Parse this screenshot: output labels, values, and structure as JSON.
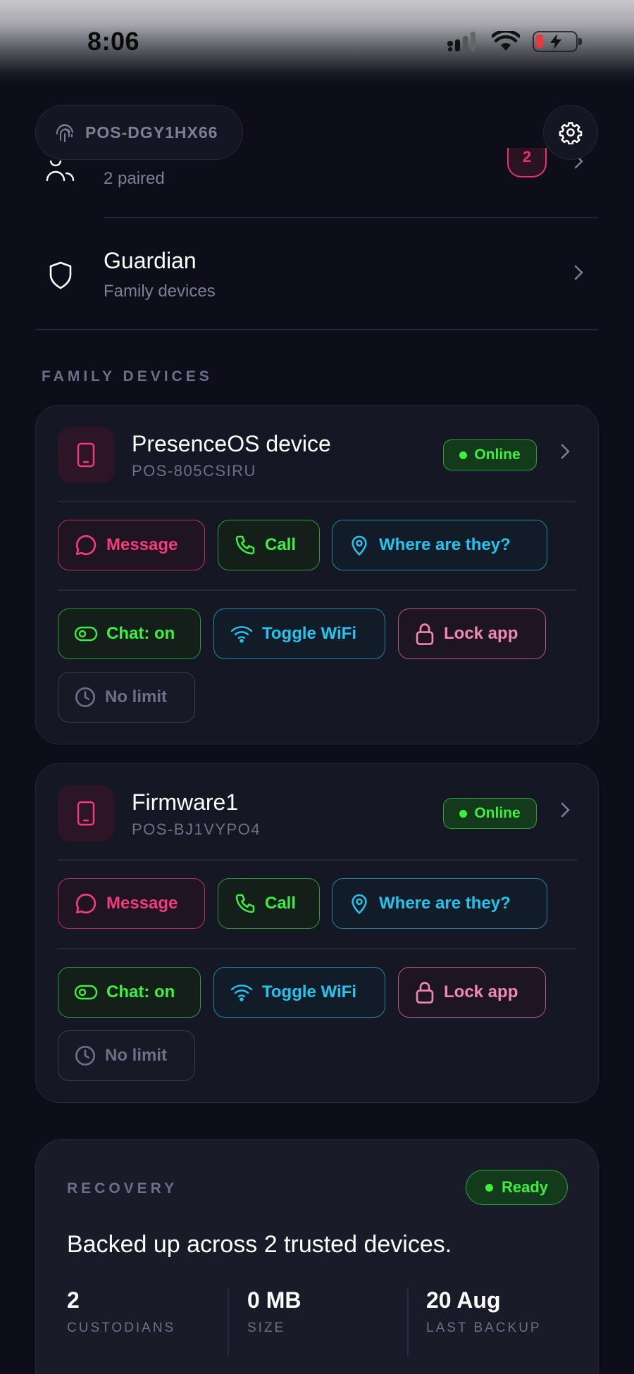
{
  "status_bar": {
    "time": "8:06"
  },
  "header": {
    "device_id": "POS-DGY1HX66"
  },
  "rows": {
    "partial": {
      "subtitle": "2 paired",
      "badge": "2"
    },
    "guardian": {
      "title": "Guardian",
      "subtitle": "Family devices"
    }
  },
  "section_title": "FAMILY DEVICES",
  "devices": [
    {
      "name": "PresenceOS device",
      "id": "POS-805CSIRU",
      "status": "Online",
      "actions": {
        "message": "Message",
        "call": "Call",
        "locate": "Where are they?"
      },
      "controls": {
        "chat": "Chat: on",
        "wifi": "Toggle WiFi",
        "lock": "Lock app",
        "limit": "No limit"
      }
    },
    {
      "name": "Firmware1",
      "id": "POS-BJ1VYPO4",
      "status": "Online",
      "actions": {
        "message": "Message",
        "call": "Call",
        "locate": "Where are they?"
      },
      "controls": {
        "chat": "Chat: on",
        "wifi": "Toggle WiFi",
        "lock": "Lock app",
        "limit": "No limit"
      }
    }
  ],
  "recovery": {
    "label": "RECOVERY",
    "status": "Ready",
    "headline": "Backed up across 2 trusted devices.",
    "stats": [
      {
        "value": "2",
        "label": "CUSTODIANS"
      },
      {
        "value": "0 MB",
        "label": "SIZE"
      },
      {
        "value": "20 Aug",
        "label": "LAST BACKUP"
      }
    ]
  },
  "colors": {
    "background": "#0d0e1a",
    "card": "#151724",
    "pink": "#f43b7d",
    "green": "#3df040",
    "cyan": "#23c4ee",
    "rose": "#f088b2",
    "muted": "#6e7088"
  }
}
